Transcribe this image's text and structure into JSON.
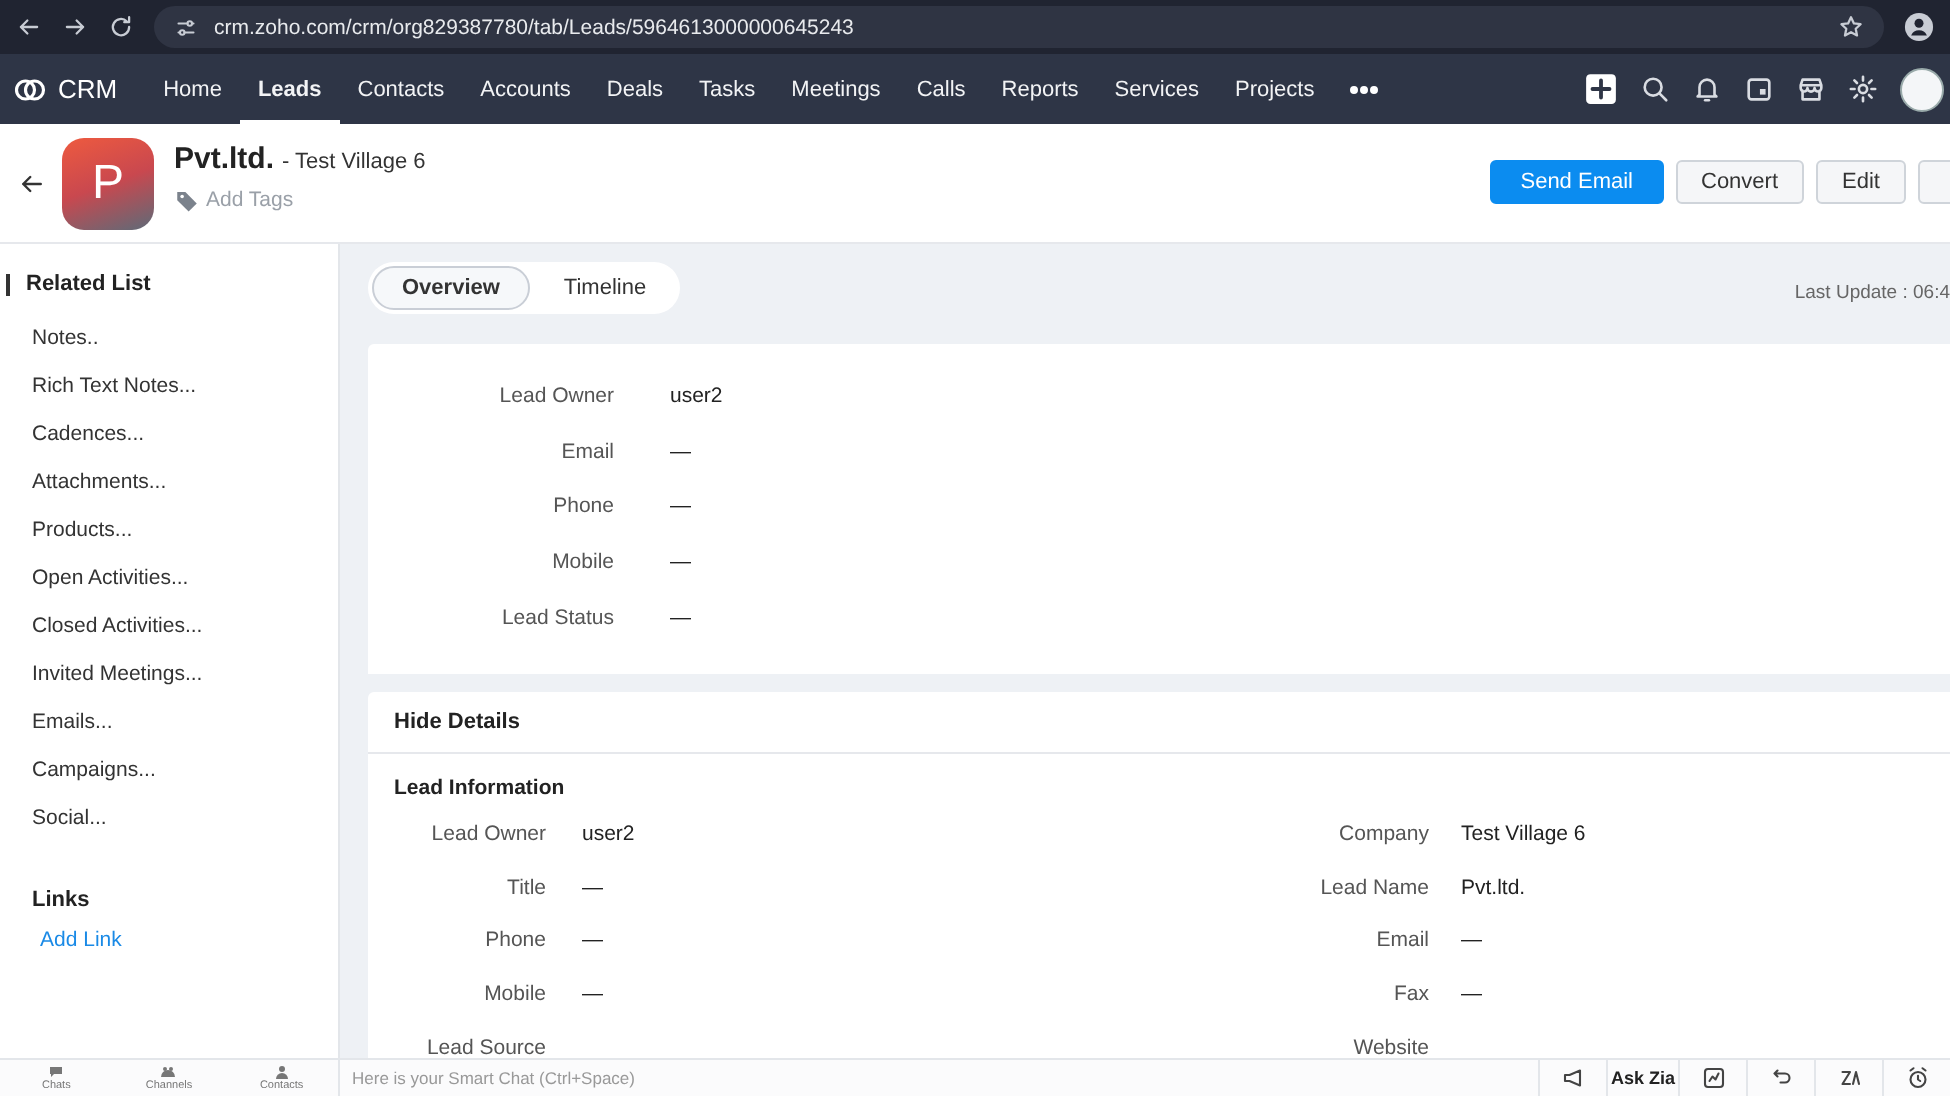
{
  "browser": {
    "url": "crm.zoho.com/crm/org829387780/tab/Leads/5964613000000645243"
  },
  "nav": {
    "brand": "CRM",
    "tabs": [
      {
        "label": "Home",
        "selected": false
      },
      {
        "label": "Leads",
        "selected": true
      },
      {
        "label": "Contacts",
        "selected": false
      },
      {
        "label": "Accounts",
        "selected": false
      },
      {
        "label": "Deals",
        "selected": false
      },
      {
        "label": "Tasks",
        "selected": false
      },
      {
        "label": "Meetings",
        "selected": false
      },
      {
        "label": "Calls",
        "selected": false
      },
      {
        "label": "Reports",
        "selected": false
      },
      {
        "label": "Services",
        "selected": false
      },
      {
        "label": "Projects",
        "selected": false
      }
    ]
  },
  "record": {
    "avatar_letter": "P",
    "name": "Pvt.ltd.",
    "company": "- Test Village 6",
    "add_tags": "Add Tags"
  },
  "actions": [
    {
      "label": "Send Email",
      "primary": true
    },
    {
      "label": "Convert",
      "primary": false
    },
    {
      "label": "Edit",
      "primary": false
    }
  ],
  "sidebar": {
    "title": "Related List",
    "items": [
      "Notes..",
      "Rich Text Notes...",
      "Cadences...",
      "Attachments...",
      "Products...",
      "Open Activities...",
      "Closed Activities...",
      "Invited Meetings...",
      "Emails...",
      "Campaigns...",
      "Social..."
    ],
    "links_title": "Links",
    "add_link": "Add Link"
  },
  "view_tabs": [
    {
      "label": "Overview",
      "selected": true
    },
    {
      "label": "Timeline",
      "selected": false
    }
  ],
  "last_update": "Last Update : 06:4",
  "summary": [
    {
      "label": "Lead Owner",
      "value": "user2"
    },
    {
      "label": "Email",
      "value": "—"
    },
    {
      "label": "Phone",
      "value": "—"
    },
    {
      "label": "Mobile",
      "value": "—"
    },
    {
      "label": "Lead Status",
      "value": "—"
    }
  ],
  "details": {
    "toggle": "Hide Details",
    "section": "Lead Information",
    "left": [
      {
        "label": "Lead Owner",
        "value": "user2"
      },
      {
        "label": "Title",
        "value": "—"
      },
      {
        "label": "Phone",
        "value": "—"
      },
      {
        "label": "Mobile",
        "value": "—"
      },
      {
        "label": "Lead Source"
      }
    ],
    "right": [
      {
        "label": "Company",
        "value": "Test Village 6"
      },
      {
        "label": "Lead Name",
        "value": "Pvt.ltd."
      },
      {
        "label": "Email",
        "value": "—"
      },
      {
        "label": "Fax",
        "value": "—"
      },
      {
        "label": "Website"
      }
    ]
  },
  "footer": {
    "tabs": [
      "Chats",
      "Channels",
      "Contacts"
    ],
    "chat_placeholder": "Here is your Smart Chat (Ctrl+Space)",
    "ask_zia": "Ask Zia"
  }
}
